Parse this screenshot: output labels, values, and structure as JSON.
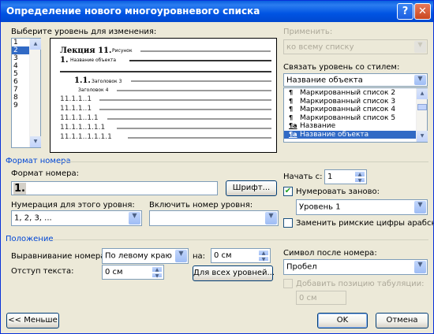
{
  "title": "Определение нового многоуровневого списка",
  "level_label": "Выберите уровень для изменения:",
  "levels": [
    "1",
    "2",
    "3",
    "4",
    "5",
    "6",
    "7",
    "8",
    "9"
  ],
  "selected_level": "2",
  "preview": {
    "l1_bold": "Лекция 11.",
    "l1_small": "Рисунок",
    "l2_bold": "1.",
    "l2_small": "Название объекта",
    "l3_bold": "1.1.",
    "l3_small": "Заголовок 3",
    "l4_small": "Заголовок 4",
    "rows": [
      "11.1.1..1",
      "11.1.1..1",
      "11.1.1..1.1",
      "11.1.1..1.1.1",
      "11.1.1..1.1.1.1"
    ]
  },
  "apply": {
    "label": "Применить:",
    "value": "ко всему списку"
  },
  "link_style": {
    "label": "Связать уровень со стилем:",
    "value": "Название объекта",
    "items": [
      {
        "icon": "¶",
        "text": "Маркированный список 2"
      },
      {
        "icon": "¶",
        "text": "Маркированный список 3"
      },
      {
        "icon": "¶",
        "text": "Маркированный список 4"
      },
      {
        "icon": "¶",
        "text": "Маркированный список 5"
      },
      {
        "icon": "¶a",
        "text": "Название"
      },
      {
        "icon": "¶a",
        "text": "Название объекта"
      }
    ]
  },
  "number_format_section": "Формат номера",
  "format_label": "Формат номера:",
  "format_value": "1.",
  "font_button": "Шрифт...",
  "numbering_label": "Нумерация для этого уровня:",
  "numbering_value": "1, 2, 3, ...",
  "include_label": "Включить номер уровня:",
  "include_value": "",
  "start_label": "Начать с:",
  "start_value": "1",
  "restart_label": "Нумеровать заново:",
  "restart_value": "Уровень 1",
  "roman_label": "Заменить римские цифры арабскими",
  "position_section": "Положение",
  "align_label": "Выравнивание номера:",
  "align_value": "По левому краю",
  "at_label": "на:",
  "at_value": "0 см",
  "indent_label": "Отступ текста:",
  "indent_value": "0 см",
  "all_levels_button": "Для всех уровней...",
  "after_label": "Символ после номера:",
  "after_value": "Пробел",
  "tab_label": "Добавить позицию табуляции:",
  "tab_value": "0 см",
  "less_button": "<< Меньше",
  "ok_button": "OK",
  "cancel_button": "Отмена"
}
